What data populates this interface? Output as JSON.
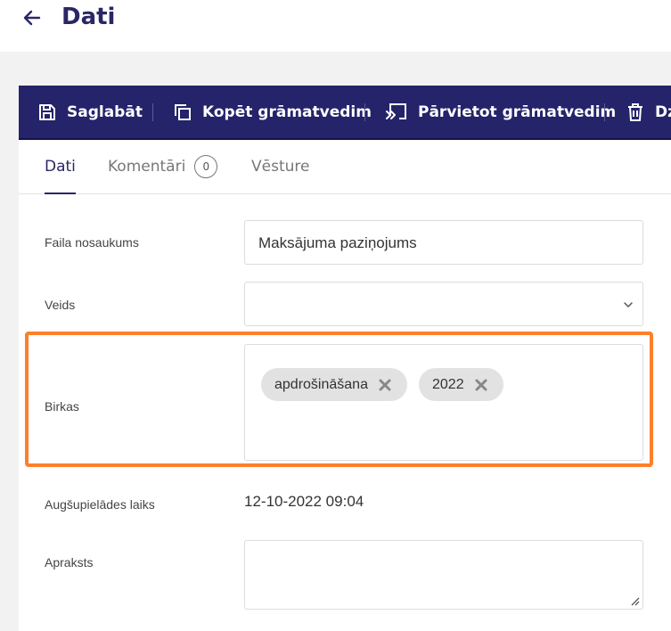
{
  "header": {
    "title": "Dati",
    "back_icon": "arrow-left-icon"
  },
  "toolbar": {
    "save_label": "Saglabāt",
    "copy_label": "Kopēt grāmatvedim",
    "move_label": "Pārvietot grāmatvedim",
    "delete_label": "Dz"
  },
  "tabs": [
    {
      "label": "Dati",
      "active": true
    },
    {
      "label": "Komentāri",
      "count": "0"
    },
    {
      "label": "Vēsture"
    }
  ],
  "form": {
    "filename_label": "Faila nosaukums",
    "filename_value": "Maksājuma paziņojums",
    "type_label": "Veids",
    "type_value": "",
    "tags_label": "Birkas",
    "tags": [
      "apdrošināšana",
      "2022"
    ],
    "upload_label": "Augšupielādes laiks",
    "upload_value": "12-10-2022 09:04",
    "description_label": "Apraksts",
    "description_value": ""
  },
  "colors": {
    "primary": "#25236a",
    "highlight": "#ff7f2a",
    "tag_bg": "#e2e2e2"
  }
}
